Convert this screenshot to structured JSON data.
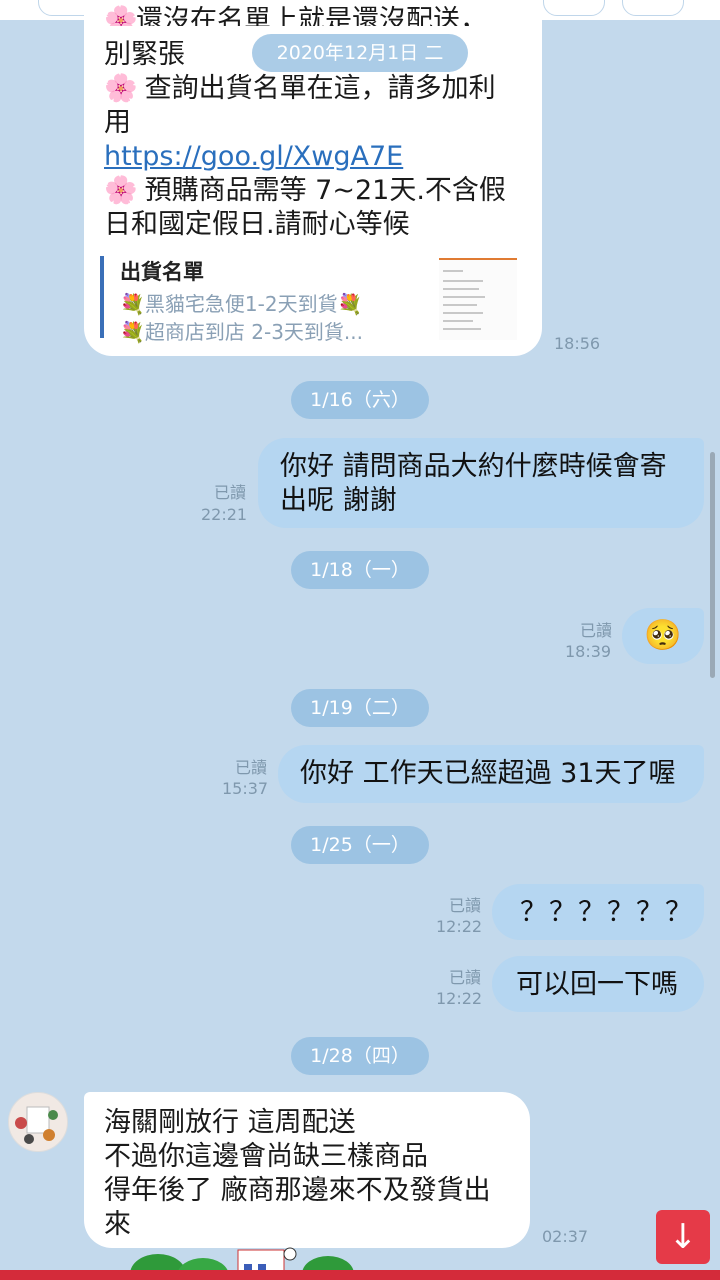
{
  "chat": {
    "floating_date": "2020年12月1日 二",
    "first_message": {
      "partial_line": "還沒在名單上就是還沒配送，",
      "lines": [
        "別緊張",
        "查詢出貨名單在這，請多加利",
        "用"
      ],
      "link": "https://goo.gl/XwgA7E",
      "lines2": [
        "預購商品需等 7~21天.不含假",
        "日和國定假日.請耐心等候"
      ],
      "preview_title": "出貨名單",
      "preview_line1": "黑貓宅急便1-2天到貨",
      "preview_line2": "超商店到店 2-3天到貨...",
      "time": "18:56"
    },
    "dates": [
      "1/16（六）",
      "1/18（一）",
      "1/19（二）",
      "1/25（一）",
      "1/28（四）"
    ],
    "read_label": "已讀",
    "outgoing": [
      {
        "lines": [
          "你好 請問商品大約什麼時候會寄",
          "出呢 謝謝"
        ],
        "time": "22:21"
      },
      {
        "text": "🥺",
        "time": "18:39"
      },
      {
        "text": "你好 工作天已經超過 31天了喔",
        "time": "15:37"
      },
      {
        "text": "？？？？？？",
        "time": "12:22"
      },
      {
        "text": "可以回一下嗎",
        "time": "12:22"
      }
    ],
    "last_incoming": {
      "lines": [
        "海關剛放行 這周配送",
        "不過你這邊會尚缺三樣商品",
        "得年後了 廠商那邊來不及發貨出",
        "來"
      ],
      "time": "02:37"
    }
  },
  "icons": {
    "flower": "🌸",
    "bouquet": "💐",
    "scroll_down": "↓"
  },
  "colors": {
    "background": "#c3d9ec",
    "outgoing_bubble": "#b5d6f1",
    "incoming_bubble": "#ffffff",
    "date_pill": "#9cc3e3",
    "scroll_button": "#e53a48"
  }
}
